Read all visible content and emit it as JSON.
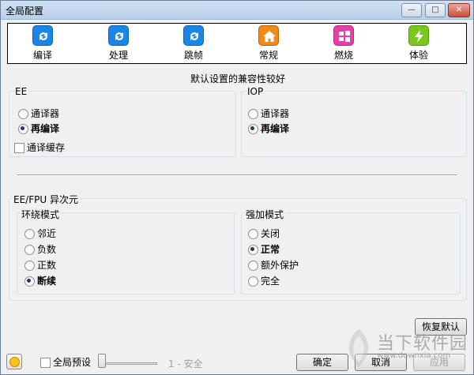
{
  "window": {
    "title": "全局配置"
  },
  "toolbar": {
    "items": [
      {
        "label": "编译",
        "color": "#1a86e8"
      },
      {
        "label": "处理",
        "color": "#1a86e8"
      },
      {
        "label": "跳帧",
        "color": "#1a86e8"
      },
      {
        "label": "常规",
        "color": "#f08a16"
      },
      {
        "label": "燃烧",
        "color": "#e83ea8"
      },
      {
        "label": "体验",
        "color": "#7ac81e"
      }
    ]
  },
  "subtitle": "默认设置的兼容性较好",
  "ee": {
    "label": "EE",
    "options": [
      "通译器",
      "再编译"
    ],
    "selected": "再编译",
    "checkbox_label": "通译缓存"
  },
  "iop": {
    "label": "IOP",
    "options": [
      "通译器",
      "再编译"
    ],
    "selected": "再编译"
  },
  "fpu": {
    "label": "EE/FPU 异次元",
    "rounding": {
      "label": "环绕模式",
      "options": [
        "邻近",
        "负数",
        "正数",
        "断续"
      ],
      "selected": "断续"
    },
    "clamping": {
      "label": "强加模式",
      "options": [
        "关闭",
        "正常",
        "额外保护",
        "完全"
      ],
      "selected": "正常"
    }
  },
  "bottom": {
    "restore_defaults": "恢复默认",
    "global_preset": "全局预设",
    "preset_level": "1 - 安全",
    "ok": "确定",
    "cancel": "取消",
    "apply": "应用"
  },
  "watermark": {
    "text": "当下软件园",
    "sub": "www.downxia.com"
  }
}
